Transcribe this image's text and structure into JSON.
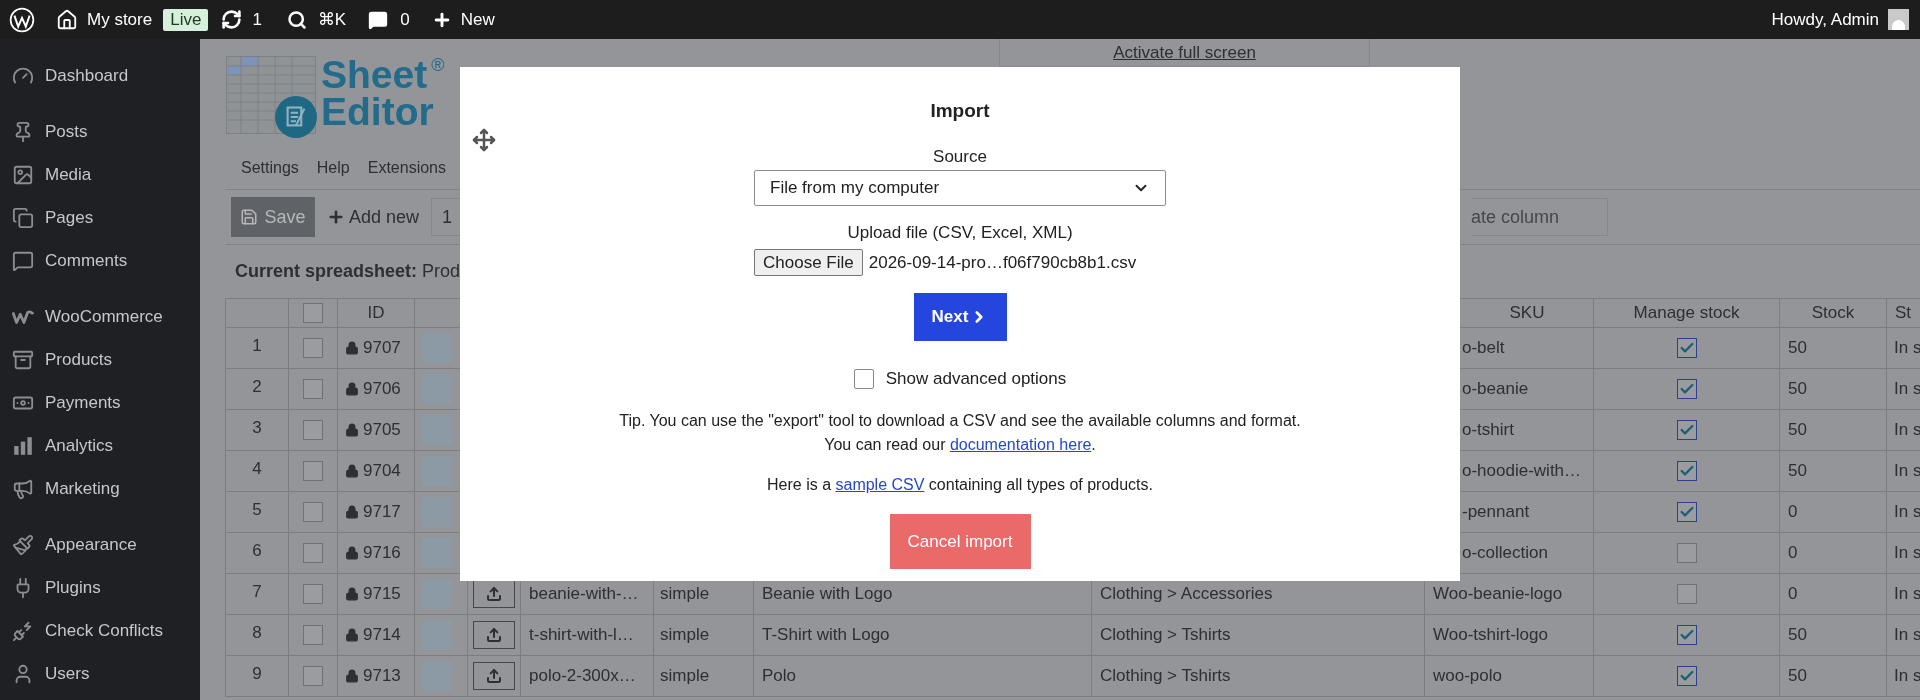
{
  "admin_bar": {
    "site": "My store",
    "status_badge": "Live",
    "updates": "1",
    "search_shortcut": "⌘K",
    "comments": "0",
    "new": "New",
    "greeting": "Howdy, Admin"
  },
  "sidebar": {
    "sections": [
      {
        "items": [
          "Dashboard"
        ]
      },
      {
        "items": [
          "Posts",
          "Media",
          "Pages",
          "Comments"
        ]
      },
      {
        "items": [
          "WooCommerce",
          "Products",
          "Payments",
          "Analytics",
          "Marketing"
        ]
      },
      {
        "items": [
          "Appearance",
          "Plugins",
          "Check Conflicts",
          "Users"
        ]
      }
    ]
  },
  "plugin": {
    "logo": {
      "line_1": "Sheet",
      "mark": "®",
      "line_2": "Editor"
    },
    "fullscreen_link": "Activate full screen",
    "menu": [
      "Settings",
      "Help",
      "Extensions"
    ],
    "toolbar": {
      "save": "Save",
      "add_new": "Add new",
      "add_count": "1",
      "locate_column": {
        "placeholder": "ate column"
      }
    },
    "current_spreadsheet": "**Current spreadsheet:** Prod"
  },
  "table": {
    "header_checkbox": {
      "checked": false
    },
    "columns": {
      "id": "ID",
      "sku": "SKU",
      "manage_stock": "Manage stock",
      "stock": "Stock",
      "column_status": "St"
    },
    "rows": [
      {
        "number": "1",
        "checked": false,
        "id": "9707",
        "sku": "o-belt",
        "manage_stock": true,
        "stock": "50",
        "status": "In s"
      },
      {
        "number": "2",
        "checked": false,
        "id": "9706",
        "sku": "o-beanie",
        "manage_stock": true,
        "stock": "50",
        "status": "In s"
      },
      {
        "number": "3",
        "checked": false,
        "id": "9705",
        "sku": "o-tshirt",
        "manage_stock": true,
        "stock": "50",
        "status": "In s"
      },
      {
        "number": "4",
        "checked": false,
        "id": "9704",
        "sku": "o-hoodie-with…",
        "manage_stock": true,
        "stock": "50",
        "status": "In s"
      },
      {
        "number": "5",
        "checked": false,
        "id": "9717",
        "sku": "-pennant",
        "manage_stock": true,
        "stock": "0",
        "status": "In s"
      },
      {
        "number": "6",
        "checked": false,
        "id": "9716",
        "sku": "o-collection",
        "manage_stock": false,
        "stock": "0",
        "status": "In s"
      },
      {
        "number": "7",
        "checked": false,
        "id": "9715",
        "file": "beanie-with-…",
        "type": "simple",
        "name": "Beanie with Logo",
        "category": "Clothing > Accessories",
        "sku": "Woo-beanie-logo",
        "manage_stock": false,
        "stock": "0",
        "status": "In s"
      },
      {
        "number": "8",
        "checked": false,
        "id": "9714",
        "file": "t-shirt-with-l…",
        "type": "simple",
        "name": "T-Shirt with Logo",
        "category": "Clothing > Tshirts",
        "sku": "Woo-tshirt-logo",
        "manage_stock": true,
        "stock": "50",
        "status": "In s"
      },
      {
        "number": "9",
        "checked": false,
        "id": "9713",
        "file": "polo-2-300x…",
        "type": "simple",
        "name": "Polo",
        "category": "Clothing > Tshirts",
        "sku": "woo-polo",
        "manage_stock": true,
        "stock": "50",
        "status": "In s"
      }
    ]
  },
  "dialog": {
    "title": "Import",
    "source_label": "Source",
    "source_value": "File from my computer",
    "upload_label": "Upload file (CSV, Excel, XML)",
    "choose_button": "Choose File",
    "file_name": "2026-09-14-pro…f06f790cb8b1.csv",
    "next_button": "Next",
    "advanced": {
      "label": "Show advanced options",
      "checked": false
    },
    "tip_line_1": "Tip. You can use the \"export\" tool to download a CSV and see the available columns and format.",
    "tip_line_2": {
      "before": "You can read our ",
      "link": "documentation here",
      "after": "."
    },
    "sample": {
      "before": "Here is a ",
      "link": "sample CSV",
      "after": " containing all types of products."
    },
    "cancel_button": "Cancel import"
  }
}
